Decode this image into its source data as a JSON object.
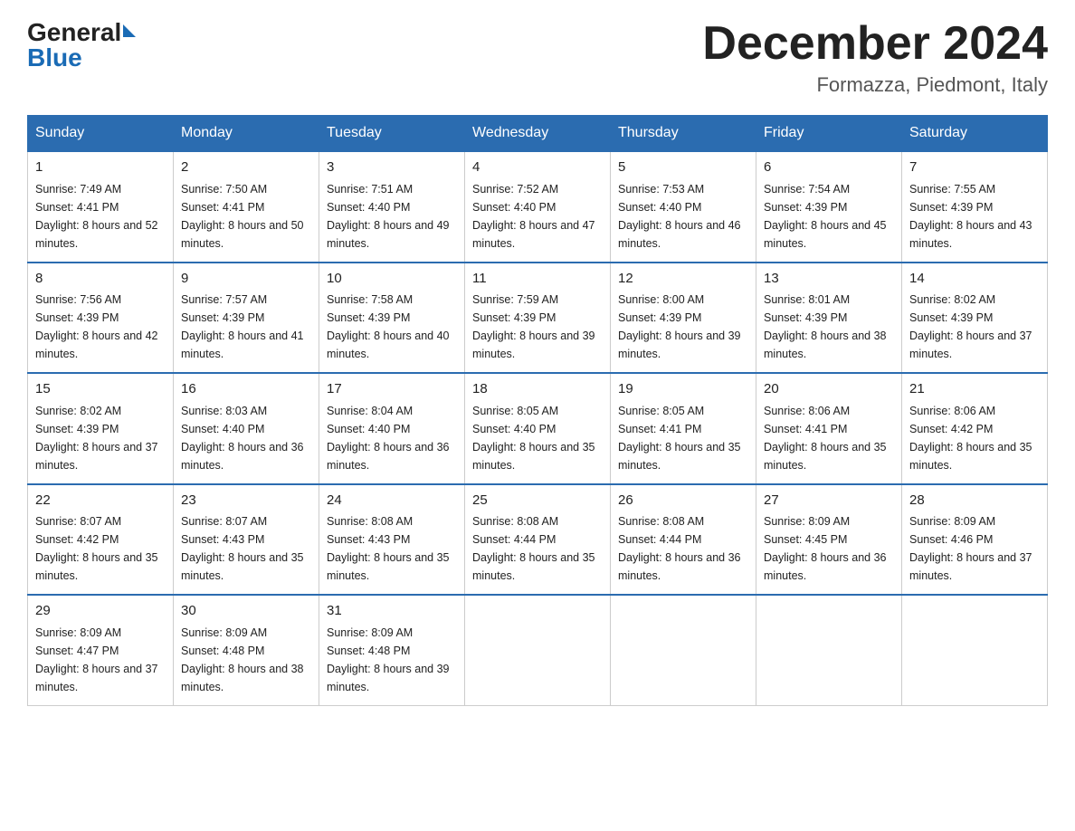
{
  "header": {
    "logo_general": "General",
    "logo_blue": "Blue",
    "month_title": "December 2024",
    "location": "Formazza, Piedmont, Italy"
  },
  "weekdays": [
    "Sunday",
    "Monday",
    "Tuesday",
    "Wednesday",
    "Thursday",
    "Friday",
    "Saturday"
  ],
  "weeks": [
    [
      {
        "day": "1",
        "sunrise": "7:49 AM",
        "sunset": "4:41 PM",
        "daylight": "8 hours and 52 minutes."
      },
      {
        "day": "2",
        "sunrise": "7:50 AM",
        "sunset": "4:41 PM",
        "daylight": "8 hours and 50 minutes."
      },
      {
        "day": "3",
        "sunrise": "7:51 AM",
        "sunset": "4:40 PM",
        "daylight": "8 hours and 49 minutes."
      },
      {
        "day": "4",
        "sunrise": "7:52 AM",
        "sunset": "4:40 PM",
        "daylight": "8 hours and 47 minutes."
      },
      {
        "day": "5",
        "sunrise": "7:53 AM",
        "sunset": "4:40 PM",
        "daylight": "8 hours and 46 minutes."
      },
      {
        "day": "6",
        "sunrise": "7:54 AM",
        "sunset": "4:39 PM",
        "daylight": "8 hours and 45 minutes."
      },
      {
        "day": "7",
        "sunrise": "7:55 AM",
        "sunset": "4:39 PM",
        "daylight": "8 hours and 43 minutes."
      }
    ],
    [
      {
        "day": "8",
        "sunrise": "7:56 AM",
        "sunset": "4:39 PM",
        "daylight": "8 hours and 42 minutes."
      },
      {
        "day": "9",
        "sunrise": "7:57 AM",
        "sunset": "4:39 PM",
        "daylight": "8 hours and 41 minutes."
      },
      {
        "day": "10",
        "sunrise": "7:58 AM",
        "sunset": "4:39 PM",
        "daylight": "8 hours and 40 minutes."
      },
      {
        "day": "11",
        "sunrise": "7:59 AM",
        "sunset": "4:39 PM",
        "daylight": "8 hours and 39 minutes."
      },
      {
        "day": "12",
        "sunrise": "8:00 AM",
        "sunset": "4:39 PM",
        "daylight": "8 hours and 39 minutes."
      },
      {
        "day": "13",
        "sunrise": "8:01 AM",
        "sunset": "4:39 PM",
        "daylight": "8 hours and 38 minutes."
      },
      {
        "day": "14",
        "sunrise": "8:02 AM",
        "sunset": "4:39 PM",
        "daylight": "8 hours and 37 minutes."
      }
    ],
    [
      {
        "day": "15",
        "sunrise": "8:02 AM",
        "sunset": "4:39 PM",
        "daylight": "8 hours and 37 minutes."
      },
      {
        "day": "16",
        "sunrise": "8:03 AM",
        "sunset": "4:40 PM",
        "daylight": "8 hours and 36 minutes."
      },
      {
        "day": "17",
        "sunrise": "8:04 AM",
        "sunset": "4:40 PM",
        "daylight": "8 hours and 36 minutes."
      },
      {
        "day": "18",
        "sunrise": "8:05 AM",
        "sunset": "4:40 PM",
        "daylight": "8 hours and 35 minutes."
      },
      {
        "day": "19",
        "sunrise": "8:05 AM",
        "sunset": "4:41 PM",
        "daylight": "8 hours and 35 minutes."
      },
      {
        "day": "20",
        "sunrise": "8:06 AM",
        "sunset": "4:41 PM",
        "daylight": "8 hours and 35 minutes."
      },
      {
        "day": "21",
        "sunrise": "8:06 AM",
        "sunset": "4:42 PM",
        "daylight": "8 hours and 35 minutes."
      }
    ],
    [
      {
        "day": "22",
        "sunrise": "8:07 AM",
        "sunset": "4:42 PM",
        "daylight": "8 hours and 35 minutes."
      },
      {
        "day": "23",
        "sunrise": "8:07 AM",
        "sunset": "4:43 PM",
        "daylight": "8 hours and 35 minutes."
      },
      {
        "day": "24",
        "sunrise": "8:08 AM",
        "sunset": "4:43 PM",
        "daylight": "8 hours and 35 minutes."
      },
      {
        "day": "25",
        "sunrise": "8:08 AM",
        "sunset": "4:44 PM",
        "daylight": "8 hours and 35 minutes."
      },
      {
        "day": "26",
        "sunrise": "8:08 AM",
        "sunset": "4:44 PM",
        "daylight": "8 hours and 36 minutes."
      },
      {
        "day": "27",
        "sunrise": "8:09 AM",
        "sunset": "4:45 PM",
        "daylight": "8 hours and 36 minutes."
      },
      {
        "day": "28",
        "sunrise": "8:09 AM",
        "sunset": "4:46 PM",
        "daylight": "8 hours and 37 minutes."
      }
    ],
    [
      {
        "day": "29",
        "sunrise": "8:09 AM",
        "sunset": "4:47 PM",
        "daylight": "8 hours and 37 minutes."
      },
      {
        "day": "30",
        "sunrise": "8:09 AM",
        "sunset": "4:48 PM",
        "daylight": "8 hours and 38 minutes."
      },
      {
        "day": "31",
        "sunrise": "8:09 AM",
        "sunset": "4:48 PM",
        "daylight": "8 hours and 39 minutes."
      },
      null,
      null,
      null,
      null
    ]
  ]
}
